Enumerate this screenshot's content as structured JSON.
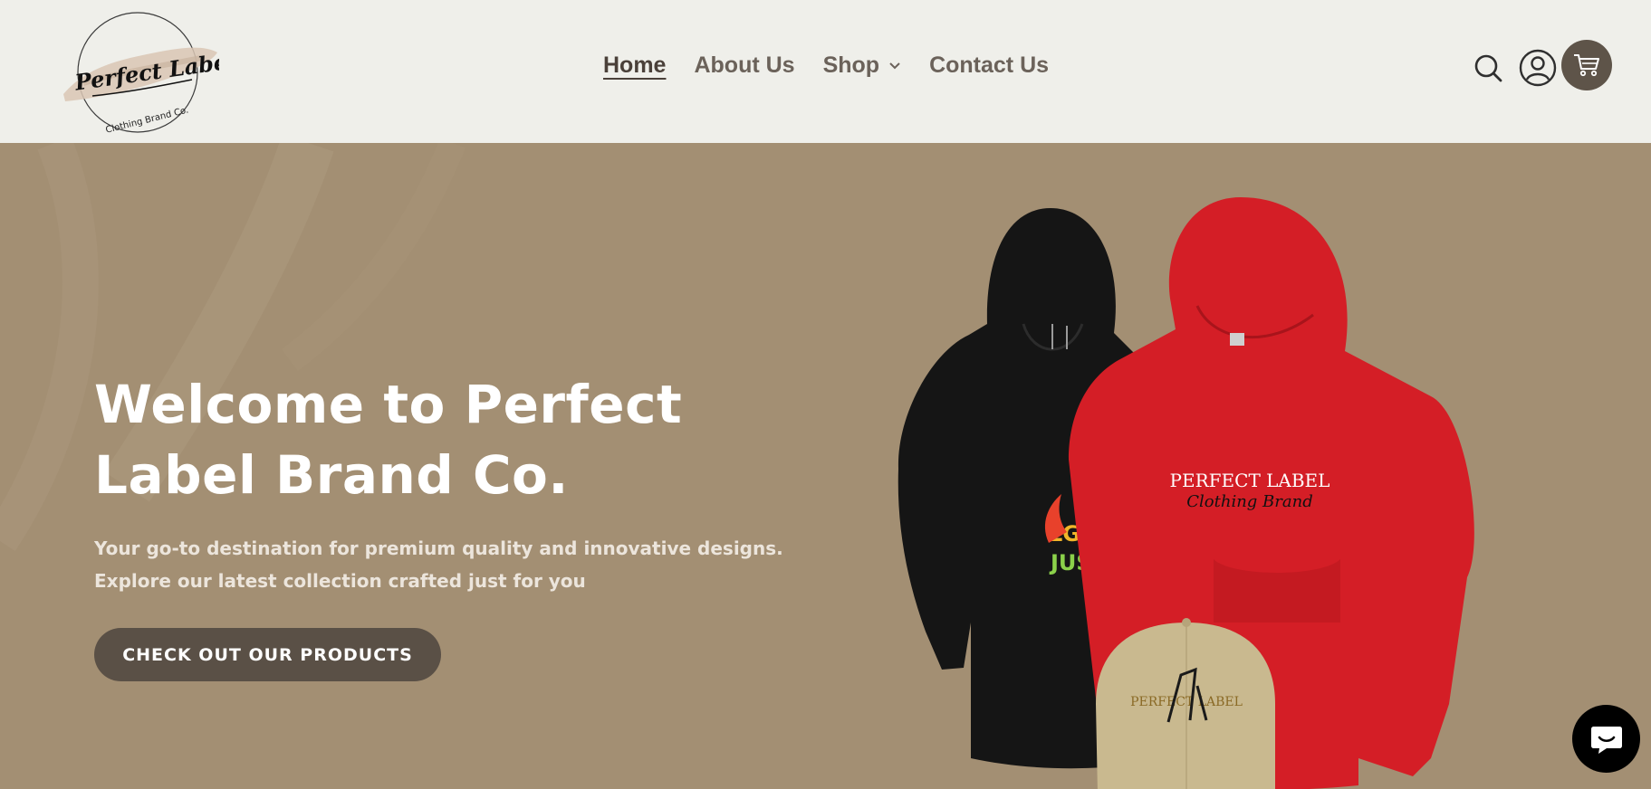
{
  "brand": {
    "logo_line1": "Perfect Label",
    "logo_line2": "Clothing Brand Co."
  },
  "nav": {
    "items": [
      {
        "label": "Home",
        "active": true
      },
      {
        "label": "About Us",
        "active": false
      },
      {
        "label": "Shop",
        "active": false,
        "has_dropdown": true
      },
      {
        "label": "Contact Us",
        "active": false
      }
    ]
  },
  "header_icons": [
    "search-icon",
    "account-icon",
    "cart-icon"
  ],
  "hero": {
    "title_line1": "Welcome to Perfect",
    "title_line2": "Label Brand Co.",
    "subtitle_line1": "Your go-to destination for premium quality and innovative designs.",
    "subtitle_line2": "Explore our latest collection crafted just for you",
    "cta_label": "CHECK OUT OUR PRODUCTS"
  },
  "products": {
    "black_hoodie_print_line1": "LGBT",
    "black_hoodie_print_line2": "JUST LO",
    "red_hoodie_print_line1": "PERFECT LABEL",
    "red_hoodie_print_line2": "Clothing Brand",
    "cap_print": "PERFECT LABEL"
  },
  "colors": {
    "header_bg": "#efefea",
    "hero_bg": "#a38f73",
    "accent_dark": "#5a5046",
    "red_hoodie": "#d41e26",
    "black_hoodie": "#151515",
    "cap": "#c9b98f"
  },
  "chat_widget": "chat-icon"
}
